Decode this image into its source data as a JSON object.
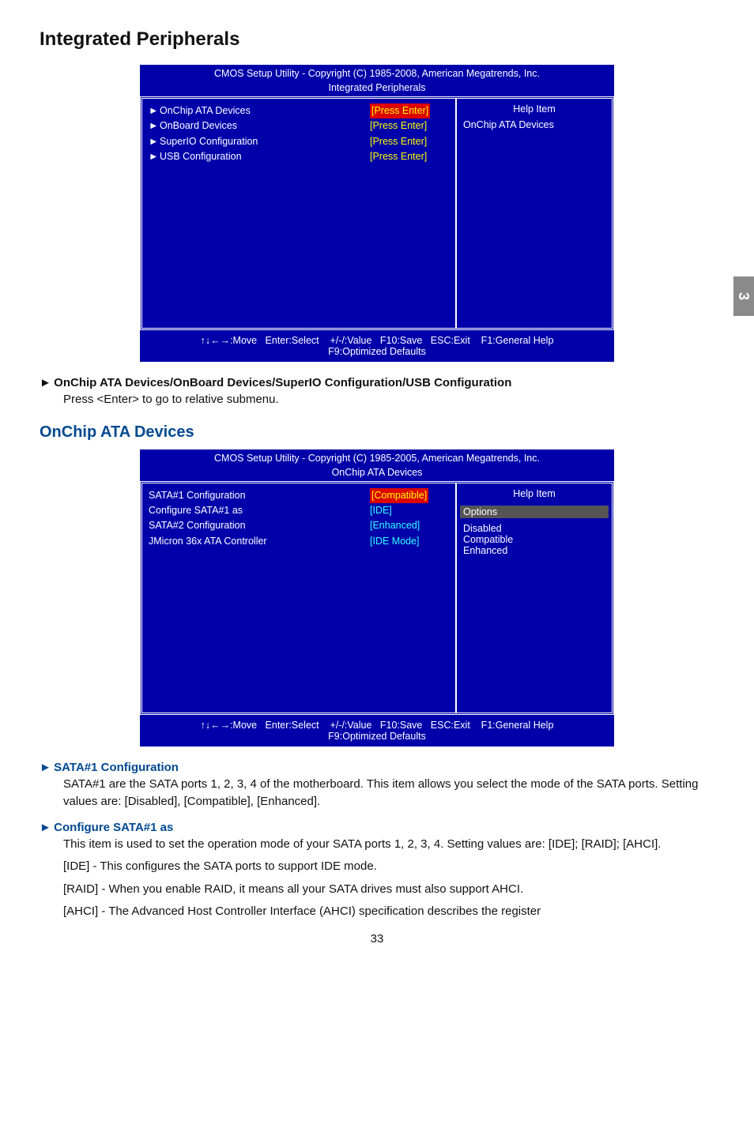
{
  "pageTab": "3",
  "headings": {
    "h1": "Integrated Peripherals",
    "h2": "OnChip ATA Devices"
  },
  "bios1": {
    "title": "CMOS Setup Utility - Copyright (C) 1985-2008, American Megatrends, Inc.",
    "subtitle": "Integrated Peripherals",
    "rows": [
      {
        "label": "OnChip ATA Devices",
        "value": "[Press Enter]",
        "highlight": true
      },
      {
        "label": "OnBoard Devices",
        "value": "[Press Enter]"
      },
      {
        "label": "SuperIO Configuration",
        "value": "[Press Enter]"
      },
      {
        "label": "USB Configuration",
        "value": "[Press Enter]"
      }
    ],
    "helpTitle": "Help Item",
    "helpBody": "OnChip ATA Devices",
    "footer": "↑↓←→:Move   Enter:Select    +/-/:Value   F10:Save   ESC:Exit    F1:General Help\nF9:Optimized Defaults"
  },
  "section1": {
    "heading": "OnChip ATA Devices/OnBoard Devices/SuperIO Configuration/USB Configuration",
    "body": "Press <Enter> to go to relative submenu."
  },
  "bios2": {
    "title": "CMOS Setup Utility - Copyright (C) 1985-2005, American Megatrends, Inc.",
    "subtitle": "OnChip ATA Devices",
    "rows": [
      {
        "label": "SATA#1 Configuration",
        "value": "[Compatible]",
        "highlight": true,
        "cyan": false
      },
      {
        "label": "Configure SATA#1 as",
        "value": "[IDE]",
        "cyan": true
      },
      {
        "label": "SATA#2 Configuration",
        "value": "[Enhanced]",
        "cyan": true
      },
      {
        "label": "JMicron 36x ATA Controller",
        "value": "[IDE Mode]",
        "cyan": true
      }
    ],
    "helpTitle": "Help Item",
    "optionsHeader": "Options",
    "options": [
      "Disabled",
      "Compatible",
      "Enhanced"
    ],
    "footer": "↑↓←→:Move   Enter:Select    +/-/:Value   F10:Save   ESC:Exit    F1:General Help\nF9:Optimized Defaults"
  },
  "section2": [
    {
      "heading": "SATA#1 Configuration",
      "body": "SATA#1 are the SATA ports 1, 2, 3, 4 of the motherboard. This item allows you select the mode of the SATA ports. Setting values are: [Disabled], [Compatible], [Enhanced]."
    },
    {
      "heading": "Configure SATA#1 as",
      "body": "This  item is used to set the operation mode of your SATA ports 1, 2, 3, 4. Setting values are: [IDE]; [RAID]; [AHCI].",
      "extras": [
        "[IDE] - This configures the SATA ports to support IDE mode.",
        "[RAID] - When you enable RAID, it means all your SATA drives must also support AHCI.",
        "[AHCI] - The Advanced Host Controller Interface (AHCI) specification describes the register"
      ]
    }
  ],
  "pageNumber": "33",
  "glyphs": {
    "arrow": "►"
  }
}
